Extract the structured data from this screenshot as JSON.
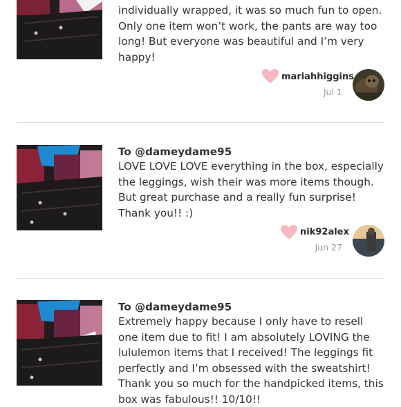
{
  "reviews": [
    {
      "to": "",
      "text": "individually wrapped, it was so much fun to open. Only one item won’t work, the pants are way too long! But everyone was beautiful and I’m very happy!",
      "username": "mariahhiggins",
      "date": "Jul 1"
    },
    {
      "to": "To @dameydame95",
      "text": "LOVE LOVE LOVE everything in the box, especially the leggings, wish their was more items though. But great purchase and a really fun surprise! Thank you!! :)",
      "username": "nik92alex",
      "date": "Jun 27"
    },
    {
      "to": "To @dameydame95",
      "text": "Extremely happy because I only have to resell one item due to fit! I am absolutely LOVING the lululemon items that I received! The leggings fit perfectly and I’m obsessed with the sweatshirt! Thank you so much for the handpicked items, this box was fabulous!! 10/10!!",
      "username": "",
      "date": ""
    }
  ],
  "colors": {
    "heart": "#f7b8c4",
    "divider": "#dcdcdc",
    "date": "#9a9a9a"
  },
  "icons": {
    "like": "heart-icon"
  }
}
